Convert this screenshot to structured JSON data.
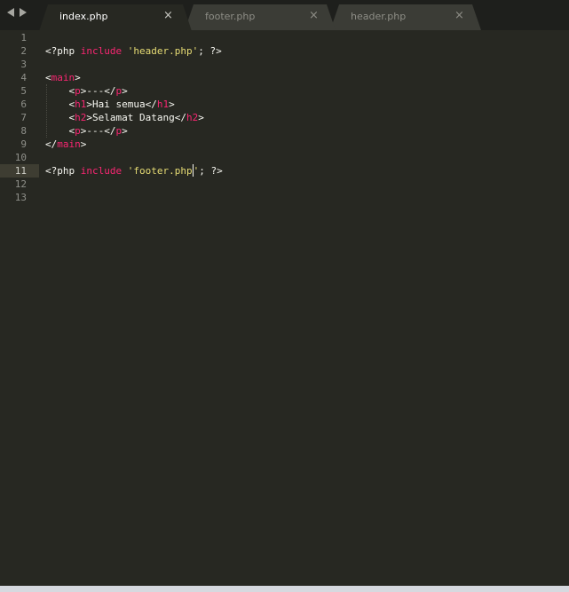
{
  "tabs": [
    {
      "label": "index.php",
      "active": true
    },
    {
      "label": "footer.php",
      "active": false
    },
    {
      "label": "header.php",
      "active": false
    }
  ],
  "close_glyph": "×",
  "editor": {
    "current_line": 11,
    "line_numbers": [
      "1",
      "2",
      "3",
      "4",
      "5",
      "6",
      "7",
      "8",
      "9",
      "10",
      "11",
      "12",
      "13"
    ],
    "lines": [
      [],
      [
        {
          "t": "plain",
          "v": "<?php "
        },
        {
          "t": "kw",
          "v": "include"
        },
        {
          "t": "plain",
          "v": " "
        },
        {
          "t": "str",
          "v": "'header.php'"
        },
        {
          "t": "plain",
          "v": "; ?>"
        }
      ],
      [],
      [
        {
          "t": "plain",
          "v": "<"
        },
        {
          "t": "tag",
          "v": "main"
        },
        {
          "t": "plain",
          "v": ">"
        }
      ],
      [
        {
          "t": "plain",
          "v": "    <"
        },
        {
          "t": "tag",
          "v": "p"
        },
        {
          "t": "plain",
          "v": ">---</"
        },
        {
          "t": "tag",
          "v": "p"
        },
        {
          "t": "plain",
          "v": ">"
        }
      ],
      [
        {
          "t": "plain",
          "v": "    <"
        },
        {
          "t": "tag",
          "v": "h1"
        },
        {
          "t": "plain",
          "v": ">Hai semua</"
        },
        {
          "t": "tag",
          "v": "h1"
        },
        {
          "t": "plain",
          "v": ">"
        }
      ],
      [
        {
          "t": "plain",
          "v": "    <"
        },
        {
          "t": "tag",
          "v": "h2"
        },
        {
          "t": "plain",
          "v": ">Selamat Datang</"
        },
        {
          "t": "tag",
          "v": "h2"
        },
        {
          "t": "plain",
          "v": ">"
        }
      ],
      [
        {
          "t": "plain",
          "v": "    <"
        },
        {
          "t": "tag",
          "v": "p"
        },
        {
          "t": "plain",
          "v": ">---</"
        },
        {
          "t": "tag",
          "v": "p"
        },
        {
          "t": "plain",
          "v": ">"
        }
      ],
      [
        {
          "t": "plain",
          "v": "</"
        },
        {
          "t": "tag",
          "v": "main"
        },
        {
          "t": "plain",
          "v": ">"
        }
      ],
      [],
      [
        {
          "t": "plain",
          "v": "<?php "
        },
        {
          "t": "kw",
          "v": "include"
        },
        {
          "t": "plain",
          "v": " "
        },
        {
          "t": "str",
          "v": "'footer.php"
        },
        {
          "t": "caret",
          "v": ""
        },
        {
          "t": "str",
          "v": "'"
        },
        {
          "t": "plain",
          "v": "; ?>"
        }
      ],
      [],
      []
    ]
  },
  "colors": {
    "background": "#272822",
    "keyword": "#f92672",
    "string": "#e6db74",
    "text": "#f8f8f2",
    "line_number": "#8f908a",
    "tab_active": "#272822",
    "tab_inactive": "#3b3c36"
  }
}
